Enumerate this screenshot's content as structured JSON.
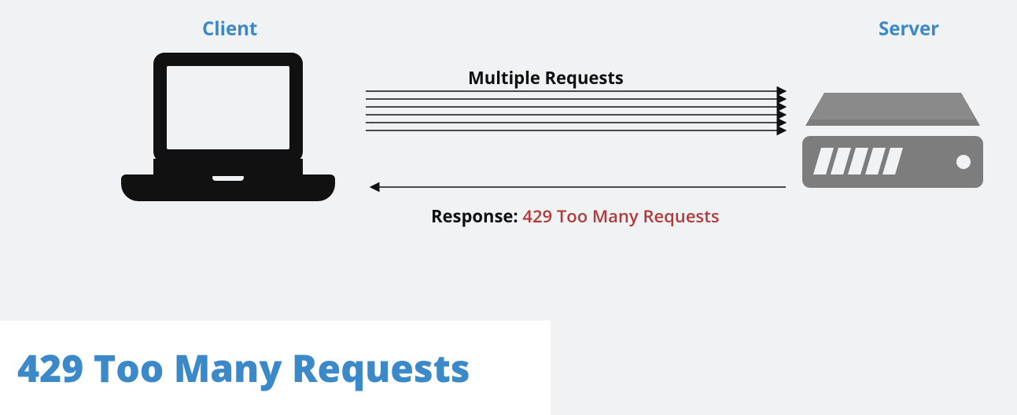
{
  "labels": {
    "client": "Client",
    "server": "Server",
    "requests": "Multiple Requests",
    "response_prefix": "Response: ",
    "response_error": "429 Too Many Requests"
  },
  "title": "429 Too Many Requests",
  "colors": {
    "accent": "#3b89c9",
    "error": "#b43a3a",
    "bg": "#f1f2f3",
    "ink": "#111111",
    "server_body": "#7d7d7d"
  }
}
